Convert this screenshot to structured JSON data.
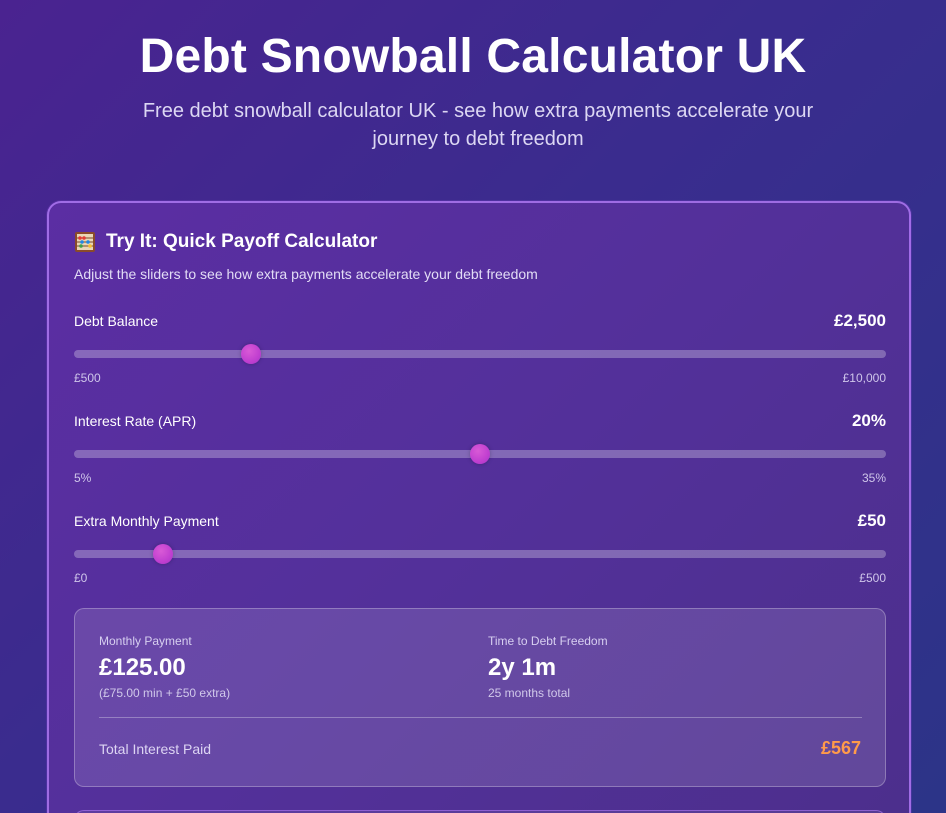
{
  "hero": {
    "title": "Debt Snowball Calculator UK",
    "subtitle": "Free debt snowball calculator UK - see how extra payments accelerate your journey to debt freedom"
  },
  "calculator": {
    "icon": "abacus-icon",
    "title": "Try It: Quick Payoff Calculator",
    "description": "Adjust the sliders to see how extra payments accelerate your debt freedom",
    "sliders": [
      {
        "label": "Debt Balance",
        "value_text": "£2,500",
        "value": 2500,
        "min": 500,
        "max": 10000,
        "min_label": "£500",
        "max_label": "£10,000"
      },
      {
        "label": "Interest Rate (APR)",
        "value_text": "20%",
        "value": 20,
        "min": 5,
        "max": 35,
        "min_label": "5%",
        "max_label": "35%"
      },
      {
        "label": "Extra Monthly Payment",
        "value_text": "£50",
        "value": 50,
        "min": 0,
        "max": 500,
        "min_label": "£0",
        "max_label": "£500"
      }
    ],
    "results": {
      "monthly_payment_label": "Monthly Payment",
      "monthly_payment_value": "£125.00",
      "monthly_payment_note": "(£75.00 min + £50 extra)",
      "time_label": "Time to Debt Freedom",
      "time_value": "2y 1m",
      "time_note": "25 months total",
      "total_interest_label": "Total Interest Paid",
      "total_interest_value": "£567"
    }
  },
  "colors": {
    "accent_orange": "#ff9a4a",
    "thumb": "#c03fd0",
    "card_border": "#ba82ff"
  }
}
